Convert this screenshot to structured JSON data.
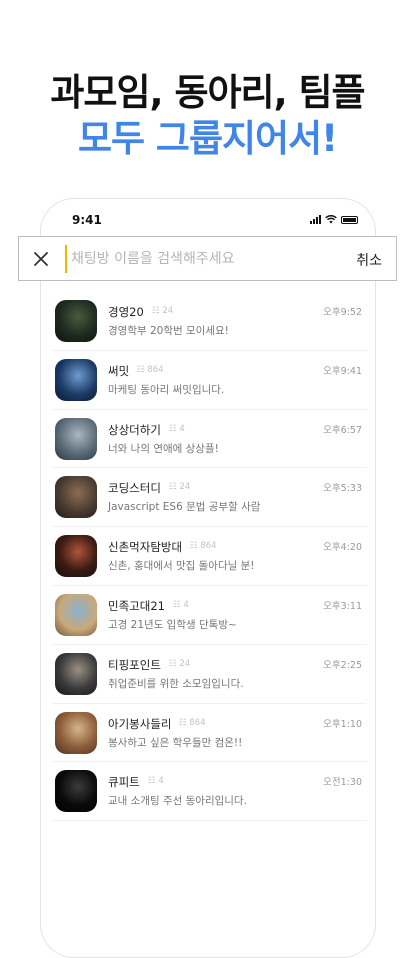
{
  "headline": {
    "line1": "과모임, 동아리, 팀플",
    "line2": "모두 그룹지어서!"
  },
  "status": {
    "time": "9:41"
  },
  "search": {
    "placeholder": "채팅방 이름을 검색해주세요",
    "value": "",
    "cancel_label": "취소"
  },
  "rooms": [
    {
      "name": "경영20",
      "members": "24",
      "desc": "경영학부 20학번 모이세요!",
      "time": "오후9:52",
      "avatar_colors": [
        "#1d2a1f",
        "#4a5a3e",
        "#0e120e"
      ]
    },
    {
      "name": "써밋",
      "members": "864",
      "desc": "마케팅 동아리 써밋입니다.",
      "time": "오후9:41",
      "avatar_colors": [
        "#1c3b66",
        "#6e9ccf",
        "#0b1630"
      ]
    },
    {
      "name": "상상더하기",
      "members": "4",
      "desc": "너와 나의 연애에 상상플!",
      "time": "오후6:57",
      "avatar_colors": [
        "#5b6b78",
        "#a9b7c2",
        "#2d3740"
      ]
    },
    {
      "name": "코딩스터디",
      "members": "24",
      "desc": "Javascript ES6 문법 공부할 사람",
      "time": "오후5:33",
      "avatar_colors": [
        "#4a3b30",
        "#8b6d55",
        "#1f1a16"
      ]
    },
    {
      "name": "신촌먹자탐방대",
      "members": "864",
      "desc": "신촌, 홍대에서 맛집 돌아다닐 분!",
      "time": "오후4:20",
      "avatar_colors": [
        "#3a1a12",
        "#b0553a",
        "#1a0e0a"
      ]
    },
    {
      "name": "민족고대21",
      "members": "4",
      "desc": "고경 21년도 입학생 단톡방~",
      "time": "오후3:11",
      "avatar_colors": [
        "#c9a97a",
        "#8ab0cf",
        "#6b5436"
      ]
    },
    {
      "name": "티핑포인트",
      "members": "24",
      "desc": "취업준비를 위한 소모임입니다.",
      "time": "오후2:25",
      "avatar_colors": [
        "#3a3a3a",
        "#9a8f85",
        "#151515"
      ]
    },
    {
      "name": "아기봉사들리",
      "members": "864",
      "desc": "봉사하고 싶은 학우들만 컴온!!",
      "time": "오후1:10",
      "avatar_colors": [
        "#8c5c3a",
        "#d6b48a",
        "#4e3322"
      ]
    },
    {
      "name": "큐피트",
      "members": "4",
      "desc": "교내 소개팅 주선 동아리입니다.",
      "time": "오전1:30",
      "avatar_colors": [
        "#0a0a0a",
        "#3b3b3b",
        "#000000"
      ]
    }
  ]
}
